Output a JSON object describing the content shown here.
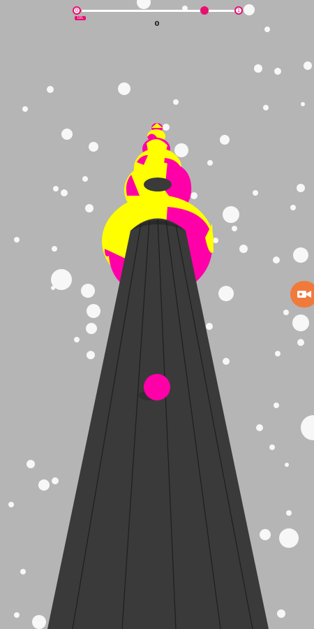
{
  "hud": {
    "score": "0",
    "start_level": "0",
    "end_level": "1",
    "progress": 0.03,
    "checkpoint_progress": 0.79,
    "start_tag": "LVL"
  },
  "colors": {
    "background": "#b5b5b5",
    "track": "#3a3a3a",
    "track_line": "#1e1e1e",
    "magenta": "#ff00a8",
    "yellow": "#ffff00",
    "accent": "#e8106f",
    "record_button": "#f07a3c"
  },
  "icons": {
    "record": "video-camera-icon"
  }
}
